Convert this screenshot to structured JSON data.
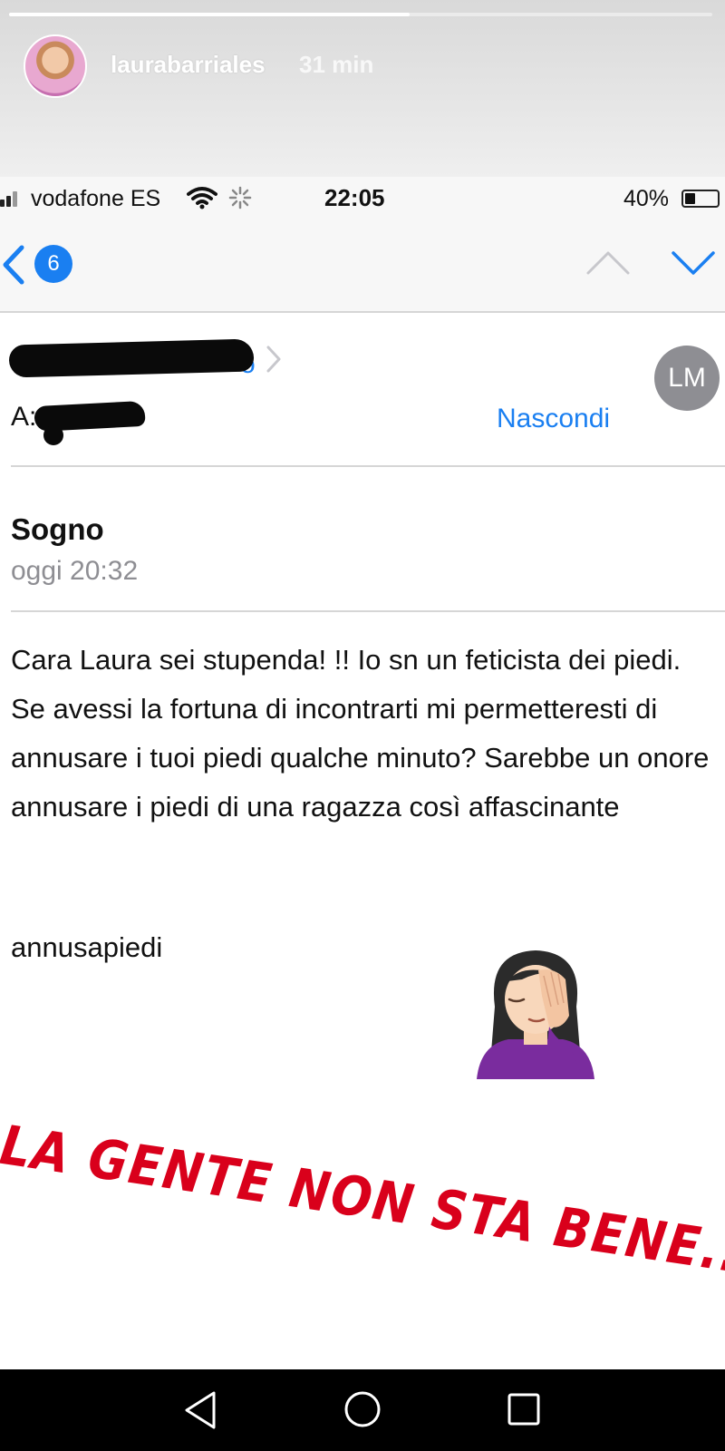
{
  "story": {
    "username": "laurabarriales",
    "time_ago": "31 min",
    "progress": 0.57,
    "overlay_caption": "LA GENTE NON STA BENE.."
  },
  "status_bar": {
    "carrier": "vodafone ES",
    "time": "22:05",
    "battery_percent_label": "40%",
    "battery_level": 0.4
  },
  "nav": {
    "back_count": "6",
    "icons": [
      "back-chevron-icon",
      "up-arrow-icon",
      "down-arrow-icon"
    ]
  },
  "mail": {
    "sender_partial": "o",
    "sender_avatar_initials": "LM",
    "to_label": "A:",
    "to_value_partial": "",
    "hide_label": "Nascondi",
    "subject": "Sogno",
    "date": "oggi 20:32",
    "body": "Cara Laura sei stupenda! !! Io sn un feticista dei piedi. Se avessi la fortuna di incontrarti mi permetteresti di annusare i tuoi piedi qualche minuto? Sarebbe un onore annusare i piedi di una ragazza così affascinante",
    "signature": "annusapiedi"
  },
  "colors": {
    "ios_blue": "#1a7ff1",
    "caption_red": "#d9001b",
    "avatar_grey": "#8e8e93"
  }
}
